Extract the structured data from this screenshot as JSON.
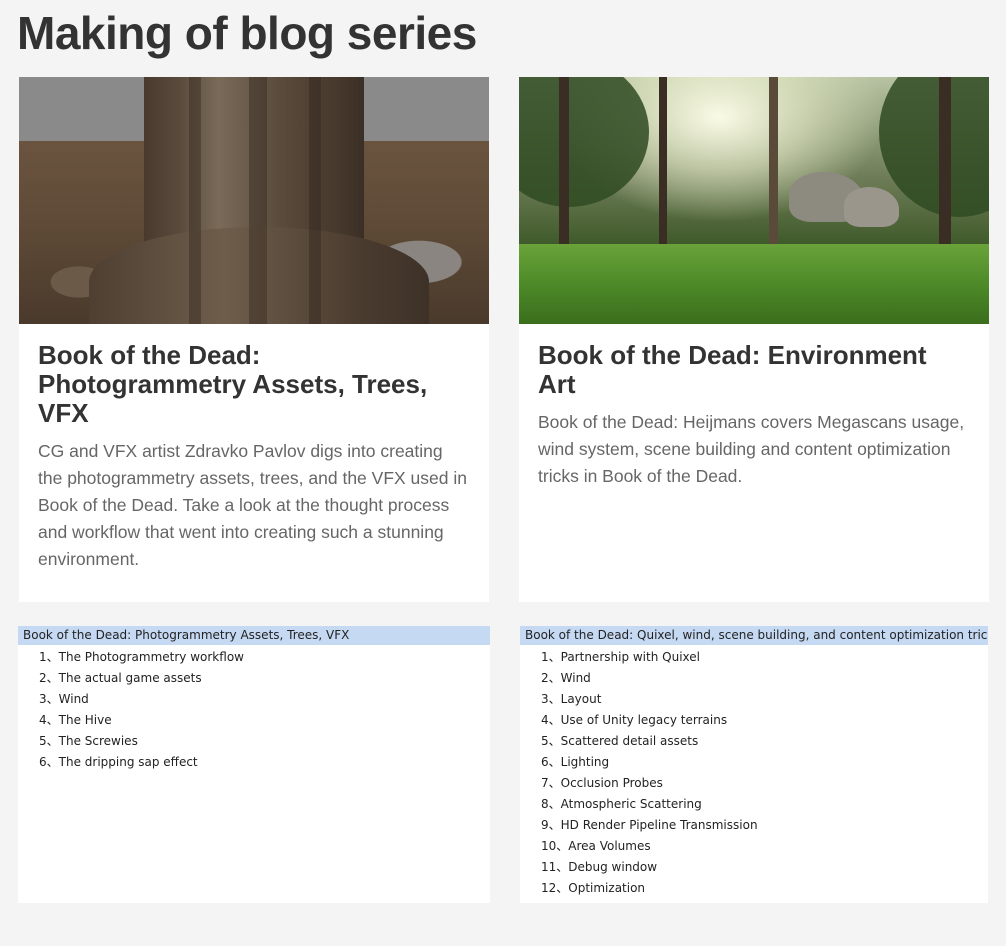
{
  "page": {
    "title": "Making of blog series"
  },
  "cards": [
    {
      "title": "Book of the Dead: Photogrammetry Assets, Trees, VFX",
      "description": "CG and VFX artist Zdravko Pavlov digs into creating the photogrammetry assets, trees, and the VFX used in Book of the Dead. Take a look at the thought process and workflow that went into creating such a stunning environment."
    },
    {
      "title": "Book of the Dead: Environment Art",
      "description": "Book of the Dead: Heijmans covers Megascans usage, wind system, scene building and content optimization tricks in Book of the Dead."
    }
  ],
  "toc": [
    {
      "header": "Book of the Dead: Photogrammetry Assets, Trees, VFX",
      "items": [
        "1、The Photogrammetry workflow",
        "2、The actual game assets",
        "3、Wind",
        "4、The Hive",
        "5、The Screwies",
        "6、The dripping sap effect"
      ]
    },
    {
      "header": "Book of the Dead: Quixel, wind, scene building, and content optimization tricks",
      "items": [
        "1、Partnership with Quixel",
        "2、Wind",
        "3、Layout",
        "4、Use of Unity legacy terrains",
        "5、Scattered detail assets",
        "6、Lighting",
        "7、Occlusion Probes",
        "8、Atmospheric Scattering",
        "9、HD Render Pipeline Transmission",
        "10、Area Volumes",
        "11、Debug window",
        "12、Optimization"
      ]
    }
  ],
  "colors": {
    "page_background": "#f4f4f4",
    "card_background": "#ffffff",
    "toc_header_background": "#c6d9f3",
    "title_text": "#333333",
    "description_text": "#666666"
  }
}
